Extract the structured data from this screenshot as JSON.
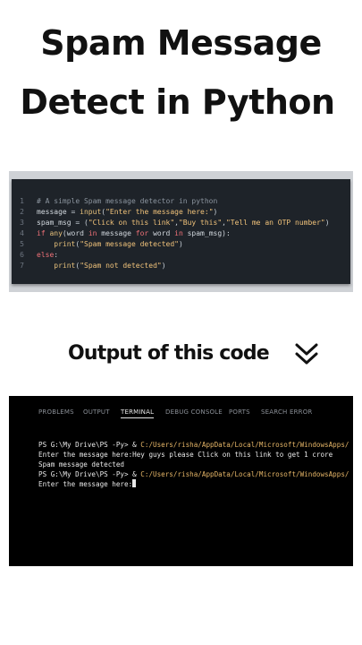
{
  "title": {
    "line1": "Spam Message",
    "line2": "Detect in Python"
  },
  "code": {
    "lines": [
      {
        "num": "1",
        "tokens": [
          {
            "t": "# A simple Spam message detector in python",
            "c": "comment"
          }
        ]
      },
      {
        "num": "2",
        "tokens": [
          {
            "t": "message ",
            "c": "var"
          },
          {
            "t": "= ",
            "c": "op"
          },
          {
            "t": "input",
            "c": "fn"
          },
          {
            "t": "(",
            "c": "op"
          },
          {
            "t": "\"Enter the message here:\"",
            "c": "str"
          },
          {
            "t": ")",
            "c": "op"
          }
        ]
      },
      {
        "num": "3",
        "tokens": [
          {
            "t": "spam_msg ",
            "c": "var"
          },
          {
            "t": "= (",
            "c": "op"
          },
          {
            "t": "\"Click on this link\"",
            "c": "str"
          },
          {
            "t": ",",
            "c": "op"
          },
          {
            "t": "\"Buy this\"",
            "c": "str"
          },
          {
            "t": ",",
            "c": "op"
          },
          {
            "t": "\"Tell me an OTP number\"",
            "c": "str"
          },
          {
            "t": ")",
            "c": "op"
          }
        ]
      },
      {
        "num": "4",
        "tokens": [
          {
            "t": "if ",
            "c": "kw"
          },
          {
            "t": "any",
            "c": "fn"
          },
          {
            "t": "(word ",
            "c": "var"
          },
          {
            "t": "in ",
            "c": "kw"
          },
          {
            "t": "message ",
            "c": "var"
          },
          {
            "t": "for ",
            "c": "kw"
          },
          {
            "t": "word ",
            "c": "var"
          },
          {
            "t": "in ",
            "c": "kw"
          },
          {
            "t": "spam_msg):",
            "c": "var"
          }
        ]
      },
      {
        "num": "5",
        "tokens": [
          {
            "t": "    ",
            "c": "var"
          },
          {
            "t": "print",
            "c": "fn"
          },
          {
            "t": "(",
            "c": "op"
          },
          {
            "t": "\"Spam message detected\"",
            "c": "str"
          },
          {
            "t": ")",
            "c": "op"
          }
        ]
      },
      {
        "num": "6",
        "tokens": [
          {
            "t": "else",
            "c": "kw"
          },
          {
            "t": ":",
            "c": "op"
          }
        ]
      },
      {
        "num": "7",
        "tokens": [
          {
            "t": "    ",
            "c": "var"
          },
          {
            "t": "print",
            "c": "fn"
          },
          {
            "t": "(",
            "c": "op"
          },
          {
            "t": "\"Spam not detected\"",
            "c": "str"
          },
          {
            "t": ")",
            "c": "op"
          }
        ]
      }
    ]
  },
  "output_heading": "Output of this code",
  "terminal": {
    "tabs": [
      {
        "label": "PROBLEMS",
        "active": false
      },
      {
        "label": "OUTPUT",
        "active": false
      },
      {
        "label": "TERMINAL",
        "active": true
      },
      {
        "label": "DEBUG CONSOLE",
        "active": false
      },
      {
        "label": "PORTS",
        "active": false
      },
      {
        "label": "SEARCH ERROR",
        "active": false
      }
    ],
    "lines": [
      {
        "prompt": "PS G:\\My Drive\\PS -Py> & ",
        "path": "C:/Users/risha/AppData/Local/Microsoft/WindowsApps/"
      },
      {
        "text": "Enter the message here:Hey guys please Click on this link to get 1 crore"
      },
      {
        "text": "Spam message detected"
      },
      {
        "prompt": "PS G:\\My Drive\\PS -Py> & ",
        "path": "C:/Users/risha/AppData/Local/Microsoft/WindowsApps/"
      },
      {
        "text": "Enter the message here:",
        "cursor": true
      }
    ]
  },
  "colors": {
    "code_bg": "#1e2329",
    "terminal_bg": "#000000",
    "string": "#f0c27a",
    "keyword": "#f07178",
    "comment": "#8b949e",
    "path_link": "#e5b567"
  },
  "icons": {
    "heading_chevron": "double-chevron-down-icon"
  }
}
